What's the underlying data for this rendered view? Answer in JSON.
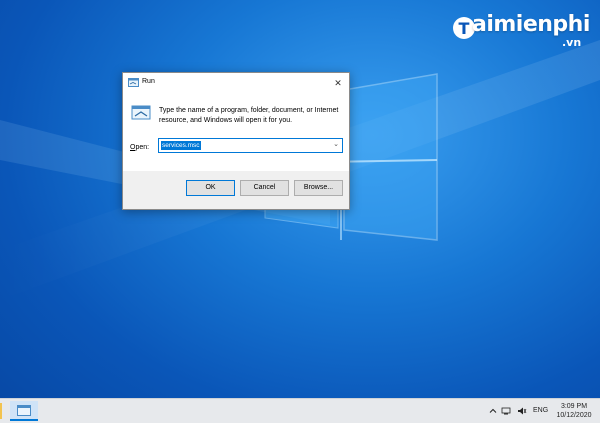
{
  "watermark": {
    "brand": "aimienphi",
    "suffix": ".vn"
  },
  "dialog": {
    "title": "Run",
    "description": "Type the name of a program, folder, document, or Internet resource, and Windows will open it for you.",
    "open_label_accel": "O",
    "open_label_rest": "pen:",
    "open_value": "services.msc",
    "ok_label": "OK",
    "cancel_label": "Cancel",
    "browse_label": "Browse..."
  },
  "taskbar": {
    "language": "ENG",
    "time": "3:09 PM",
    "date": "10/12/2020"
  },
  "colors": {
    "accent": "#0078d7",
    "desktop": "#1777d4"
  },
  "icons": [
    "run-icon",
    "close-icon",
    "chevron-down-icon",
    "network-icon",
    "volume-icon",
    "notification-icon"
  ]
}
